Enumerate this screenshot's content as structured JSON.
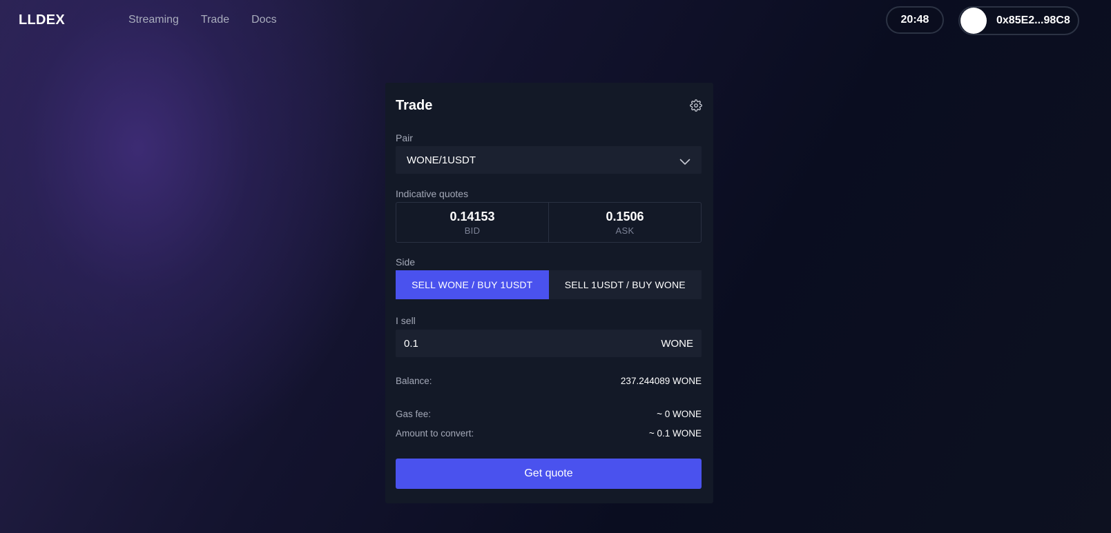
{
  "app": {
    "logo": "LLDEX"
  },
  "nav": {
    "items": [
      {
        "label": "Streaming"
      },
      {
        "label": "Trade"
      },
      {
        "label": "Docs"
      }
    ]
  },
  "header": {
    "time": "20:48",
    "wallet_address": "0x85E2...98C8"
  },
  "trade": {
    "title": "Trade",
    "pair_label": "Pair",
    "pair_value": "WONE/1USDT",
    "quotes_label": "Indicative quotes",
    "bid": {
      "value": "0.14153",
      "label": "BID"
    },
    "ask": {
      "value": "0.1506",
      "label": "ASK"
    },
    "side_label": "Side",
    "side_options": [
      {
        "label": "SELL WONE / BUY 1USDT",
        "selected": true
      },
      {
        "label": "SELL 1USDT / BUY WONE",
        "selected": false
      }
    ],
    "sell_label": "I sell",
    "sell_amount": "0.1",
    "sell_unit": "WONE",
    "balance_label": "Balance:",
    "balance_value": "237.244089 WONE",
    "gas_label": "Gas fee:",
    "gas_value": "~ 0 WONE",
    "convert_label": "Amount to convert:",
    "convert_value": "~ 0.1 WONE",
    "submit_label": "Get quote"
  },
  "icons": {
    "settings": "gear-icon",
    "pair_dropdown": "chevron-down-icon"
  },
  "colors": {
    "accent": "#4a52ee",
    "card": "#131927",
    "field": "#1b2130"
  }
}
